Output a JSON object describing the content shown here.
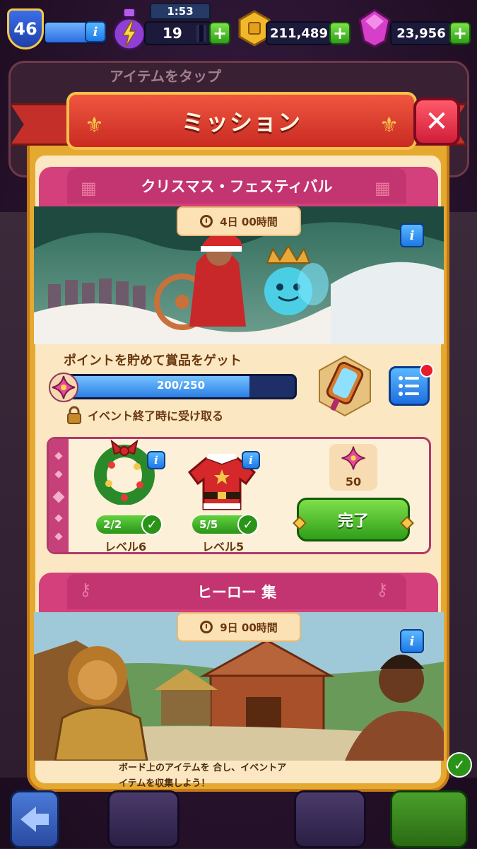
{
  "hud": {
    "level": "46",
    "xp_fraction": 0.7,
    "timer": "1:53",
    "energy": "19",
    "coins": "211,489",
    "gems": "23,956"
  },
  "background_panel": {
    "hint": "アイテムをタップ"
  },
  "modal": {
    "title": "ミッション"
  },
  "christmas": {
    "section_title": "クリスマス・フェスティバル",
    "time_left": "4日 00時間",
    "goal_text": "ポイントを貯めて賞品をゲット",
    "progress_label": "200/250",
    "progress_fraction": 0.8,
    "receive_note": "イベント終了時に受け取る",
    "items": [
      {
        "name": "wreath",
        "count": "2/2",
        "level": "レベル6"
      },
      {
        "name": "santa-coat",
        "count": "5/5",
        "level": "レベル5"
      }
    ],
    "reward_points": "50",
    "complete_button": "完了"
  },
  "heroes": {
    "section_title": "ヒーロー 集",
    "time_left": "9日 00時間",
    "description": "ボード上のアイテムを 合し、イベントアイテムを収集しよう！"
  },
  "colors": {
    "accent_red": "#d11e3a",
    "section_pink": "#c33570",
    "button_green": "#2f9e1a",
    "info_blue": "#1e78e6"
  }
}
